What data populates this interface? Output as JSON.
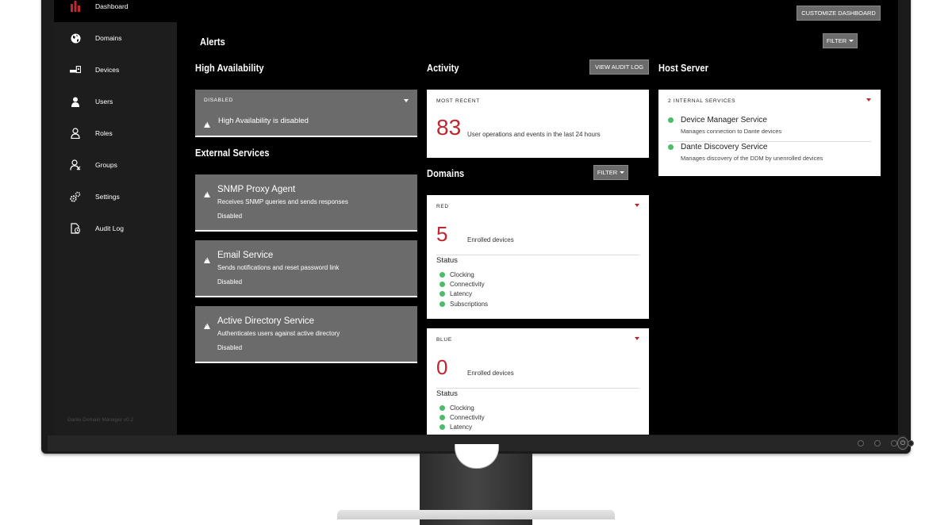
{
  "sidebar": {
    "items": [
      {
        "label": "Dashboard",
        "icon": "dashboard-bars-icon"
      },
      {
        "label": "Domains",
        "icon": "globe-icon"
      },
      {
        "label": "Devices",
        "icon": "devices-icon"
      },
      {
        "label": "Users",
        "icon": "user-icon"
      },
      {
        "label": "Roles",
        "icon": "role-icon"
      },
      {
        "label": "Groups",
        "icon": "groups-icon"
      },
      {
        "label": "Settings",
        "icon": "gears-icon"
      },
      {
        "label": "Audit Log",
        "icon": "audit-log-icon"
      }
    ],
    "version": "Dante Domain Manager v0.2"
  },
  "header": {
    "customize_label": "CUSTOMIZE DASHBOARD",
    "alerts_title": "Alerts",
    "filter_label": "FILTER"
  },
  "high_availability": {
    "title": "High Availability",
    "state": "DISABLED",
    "message": "High Availability is disabled"
  },
  "external_services": {
    "title": "External Services",
    "items": [
      {
        "name": "SNMP Proxy Agent",
        "description": "Receives SNMP queries and sends responses",
        "status": "Disabled"
      },
      {
        "name": "Email Service",
        "description": "Sends notifications and reset password link",
        "status": "Disabled"
      },
      {
        "name": "Active Directory Service",
        "description": "Authenticates users against active directory",
        "status": "Disabled"
      }
    ]
  },
  "activity": {
    "title": "Activity",
    "audit_button": "VIEW AUDIT LOG",
    "head": "MOST RECENT",
    "count": "83",
    "description": "User operations and events in the last 24 hours"
  },
  "domains": {
    "title": "Domains",
    "filter_label": "FILTER",
    "status_title": "Status",
    "enrolled_label": "Enrolled devices",
    "cards": [
      {
        "name": "RED",
        "count": "5",
        "statuses": [
          "Clocking",
          "Connectivity",
          "Latency",
          "Subscriptions"
        ]
      },
      {
        "name": "BLUE",
        "count": "0",
        "statuses": [
          "Clocking",
          "Connectivity",
          "Latency"
        ]
      }
    ]
  },
  "host_server": {
    "title": "Host Server",
    "head": "2 INTERNAL SERVICES",
    "services": [
      {
        "name": "Device Manager Service",
        "description": "Manages connection to Dante devices"
      },
      {
        "name": "Dante Discovery Service",
        "description": "Manages discovery of the DDM by unenrolled devices"
      }
    ]
  },
  "colors": {
    "accent_red": "#c0262d",
    "status_green": "#4cbb6c",
    "panel_grey": "#6b6b6b"
  }
}
